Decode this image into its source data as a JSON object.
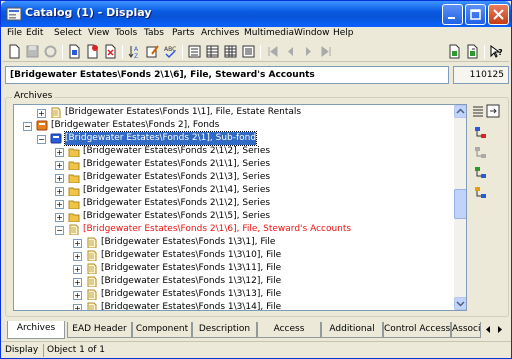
{
  "window": {
    "title": "Catalog (1) - Display"
  },
  "menu": [
    "File",
    "Edit",
    "Select",
    "View",
    "Tools",
    "Tabs",
    "Parts",
    "Archives",
    "Multimedia",
    "Window",
    "Help"
  ],
  "record": {
    "title": "[Bridgewater Estates\\Fonds 2\\1\\6], File, Steward's Accounts",
    "id": "110125"
  },
  "panel": {
    "label": "Archives"
  },
  "tree": [
    {
      "text": "[Bridgewater Estates\\Fonds 1\\1], File, Estate Rentals",
      "level": 1,
      "icon": "file",
      "style": "normal"
    },
    {
      "text": "[Bridgewater Estates\\Fonds 2], Fonds",
      "level": 0,
      "icon": "fonds",
      "style": "normal",
      "expanded": true
    },
    {
      "text": "[Bridgewater Estates\\Fonds 2\\1], Sub-fond",
      "level": 1,
      "icon": "subfonds",
      "style": "selected",
      "expanded": true
    },
    {
      "text": "[Bridgewater Estates\\Fonds 2\\1\\2], Series",
      "level": 2,
      "icon": "folder",
      "style": "normal"
    },
    {
      "text": "[Bridgewater Estates\\Fonds 2\\1\\1], Series",
      "level": 2,
      "icon": "folder",
      "style": "normal"
    },
    {
      "text": "[Bridgewater Estates\\Fonds 2\\1\\3], Series",
      "level": 2,
      "icon": "folder",
      "style": "normal"
    },
    {
      "text": "[Bridgewater Estates\\Fonds 2\\1\\4], Series",
      "level": 2,
      "icon": "folder",
      "style": "normal"
    },
    {
      "text": "[Bridgewater Estates\\Fonds 2\\1\\2], Series",
      "level": 2,
      "icon": "folder",
      "style": "normal"
    },
    {
      "text": "[Bridgewater Estates\\Fonds 2\\1\\5], Series",
      "level": 2,
      "icon": "folder",
      "style": "normal"
    },
    {
      "text": "[Bridgewater Estates\\Fonds 2\\1\\6], File, Steward's Accounts",
      "level": 2,
      "icon": "file",
      "style": "current",
      "expanded": true
    },
    {
      "text": "[Bridgewater Estates\\Fonds 1\\3\\1], File",
      "level": 3,
      "icon": "file",
      "style": "normal"
    },
    {
      "text": "[Bridgewater Estates\\Fonds 1\\3\\10], File",
      "level": 3,
      "icon": "file",
      "style": "normal"
    },
    {
      "text": "[Bridgewater Estates\\Fonds 1\\3\\11], File",
      "level": 3,
      "icon": "file",
      "style": "normal"
    },
    {
      "text": "[Bridgewater Estates\\Fonds 1\\3\\12], File",
      "level": 3,
      "icon": "file",
      "style": "normal"
    },
    {
      "text": "[Bridgewater Estates\\Fonds 1\\3\\13], File",
      "level": 3,
      "icon": "file",
      "style": "normal"
    },
    {
      "text": "[Bridgewater Estates\\Fonds 1\\3\\14], File",
      "level": 3,
      "icon": "file",
      "style": "normal"
    }
  ],
  "tabs": [
    "Archives",
    "EAD Header",
    "Component",
    "Description",
    "Access",
    "Additional",
    "Control Access",
    "Associ"
  ],
  "status": {
    "mode": "Display",
    "position": "Object 1 of 1"
  },
  "colors": {
    "title_bar": "#0a5be3",
    "selection": "#316ac5",
    "current_record": "#e11111"
  }
}
